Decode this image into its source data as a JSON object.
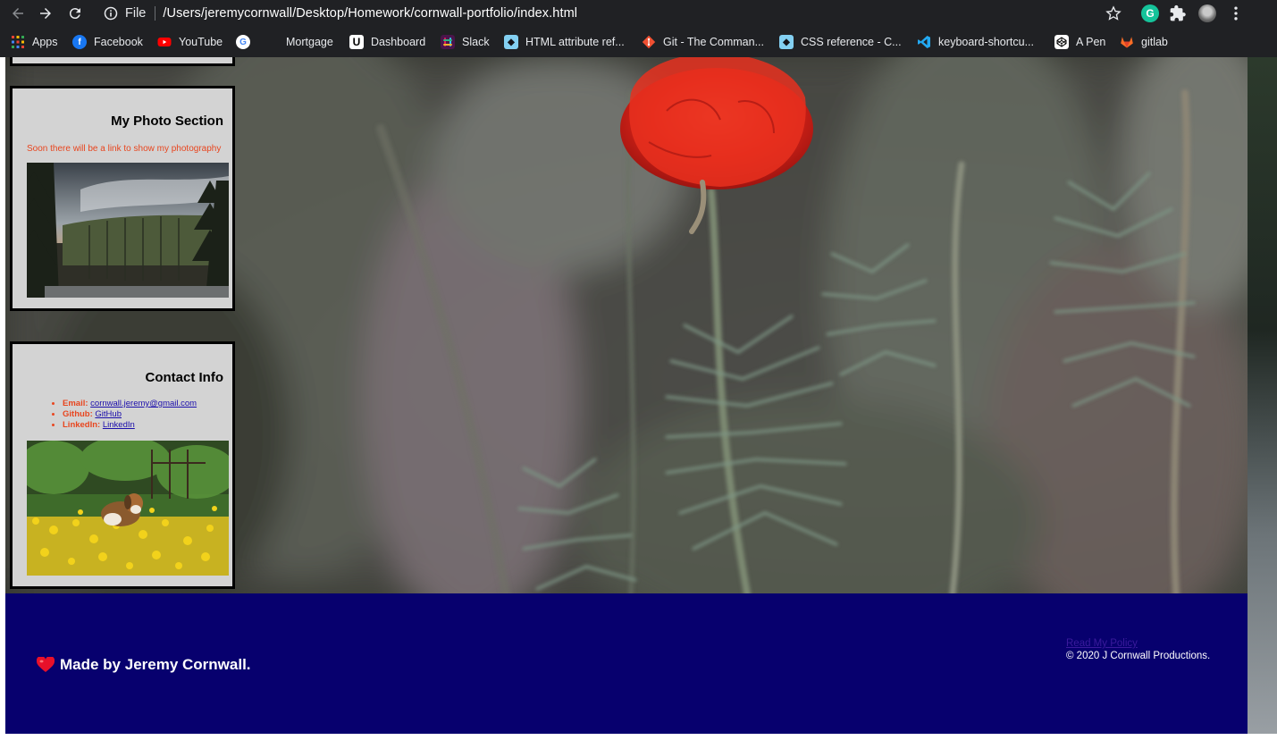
{
  "browser": {
    "scheme": "File",
    "url": "/Users/jeremycornwall/Desktop/Homework/cornwall-portfolio/index.html",
    "bookmarks": [
      {
        "label": "Apps",
        "icon": "apps-grid-icon"
      },
      {
        "label": "Facebook",
        "icon": "facebook-icon"
      },
      {
        "label": "YouTube",
        "icon": "youtube-icon"
      },
      {
        "label": "",
        "icon": "google-icon"
      },
      {
        "label": "Mortgage",
        "icon": "none"
      },
      {
        "label": "Dashboard",
        "icon": "utah-u-icon"
      },
      {
        "label": "Slack",
        "icon": "slack-icon"
      },
      {
        "label": "HTML attribute ref...",
        "icon": "mdn-icon"
      },
      {
        "label": "Git - The Comman...",
        "icon": "git-icon"
      },
      {
        "label": "CSS reference - C...",
        "icon": "mdn-icon"
      },
      {
        "label": "keyboard-shortcu...",
        "icon": "vscode-icon"
      },
      {
        "label": "A Pen",
        "icon": "codepen-icon"
      },
      {
        "label": "gitlab",
        "icon": "gitlab-icon"
      }
    ],
    "extension_letter": "G"
  },
  "sidebar": {
    "photo_section": {
      "title": "My Photo Section",
      "text": "Soon there will be a link to show my photography"
    },
    "contact": {
      "title": "Contact Info",
      "items": [
        {
          "key": "Email:",
          "link": "cornwall.jeremy@gmail.com"
        },
        {
          "key": "Github:",
          "link": "GitHub"
        },
        {
          "key": "LinkedIn:",
          "link": "LinkedIn"
        }
      ]
    }
  },
  "footer": {
    "made_by": "Made by Jeremy Cornwall.",
    "policy_link": "Read My Policy",
    "copyright": "© 2020 J Cornwall Productions."
  },
  "colors": {
    "footer_bg": "#07006e",
    "card_bg": "#d3d3d3",
    "accent_text": "#e8461f"
  }
}
